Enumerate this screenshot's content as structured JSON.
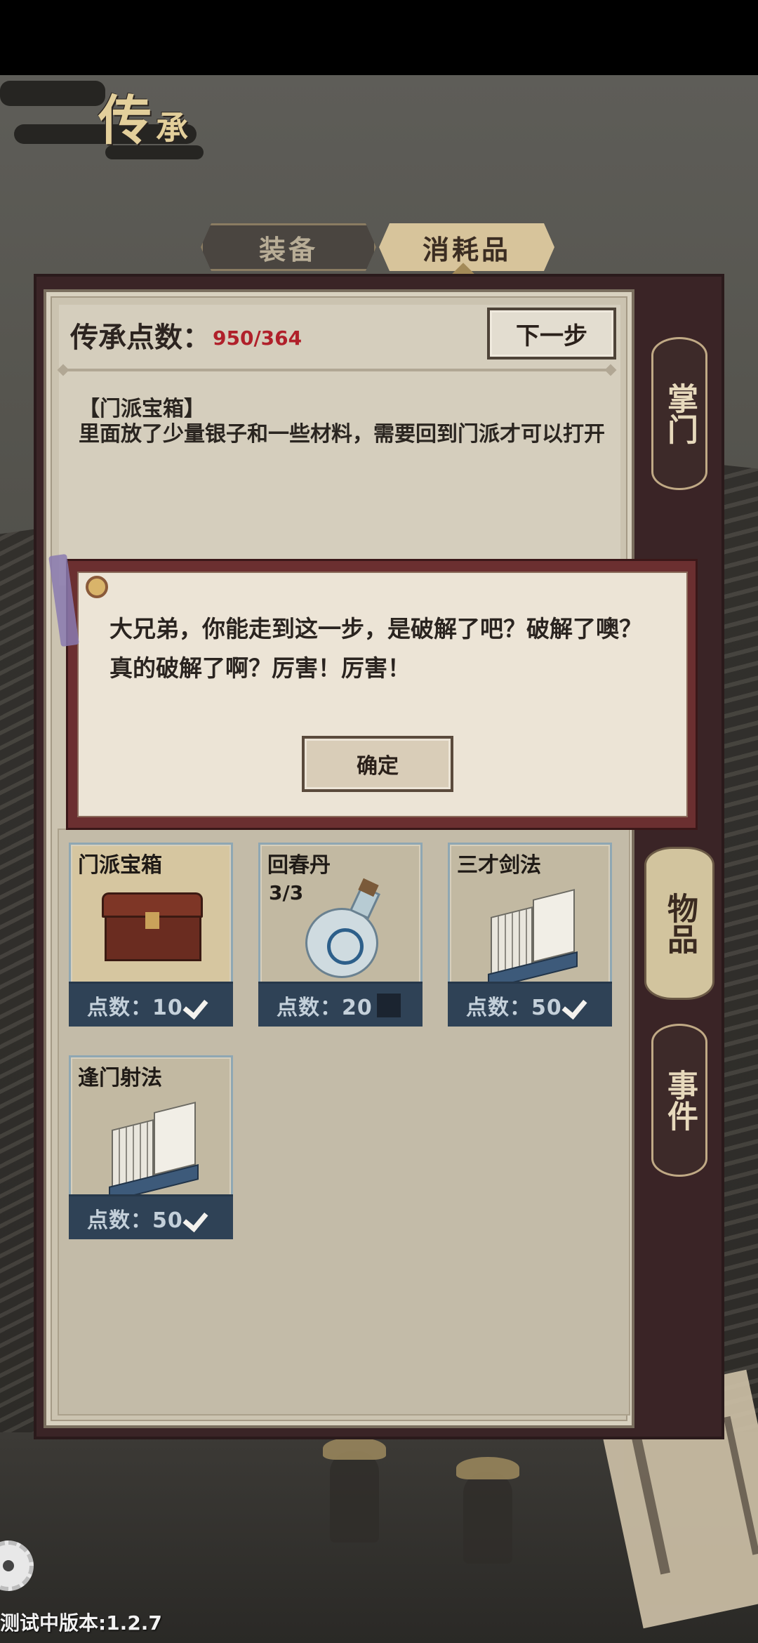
{
  "page": {
    "title_big": "传",
    "title_small": "承"
  },
  "category_tabs": [
    {
      "label": "装备",
      "active": false
    },
    {
      "label": "消耗品",
      "active": true
    }
  ],
  "inheritance": {
    "points_label": "传承点数：",
    "points_value": "950/364",
    "next_button": "下一步"
  },
  "selected_item": {
    "name": "【门派宝箱】",
    "description": "里面放了少量银子和一些材料，需要回到门派才可以打开"
  },
  "side_tabs": [
    {
      "label": "掌门",
      "active": false
    },
    {
      "label": "物品",
      "active": true
    },
    {
      "label": "事件",
      "active": false
    }
  ],
  "items": [
    {
      "name": "门派宝箱",
      "count": "",
      "points": "点数：10",
      "checked": true,
      "icon": "treasure-chest-icon"
    },
    {
      "name": "回春丹",
      "count": "3/3",
      "points": "点数：20",
      "checked": false,
      "icon": "potion-bottle-icon"
    },
    {
      "name": "三才剑法",
      "count": "",
      "points": "点数：50",
      "checked": true,
      "icon": "manual-book-icon"
    },
    {
      "name": "逢门射法",
      "count": "",
      "points": "点数：50",
      "checked": true,
      "icon": "manual-book-icon"
    }
  ],
  "dialog": {
    "message": "大兄弟，你能走到这一步，是破解了吧？破解了噢？真的破解了啊？厉害！厉害！",
    "confirm_button": "确定"
  },
  "footer": {
    "version": "测试中版本:1.2.7"
  },
  "colors": {
    "points_value": "#b0202a",
    "dialog_border": "#6b2f30",
    "item_footer": "#2f4256"
  }
}
